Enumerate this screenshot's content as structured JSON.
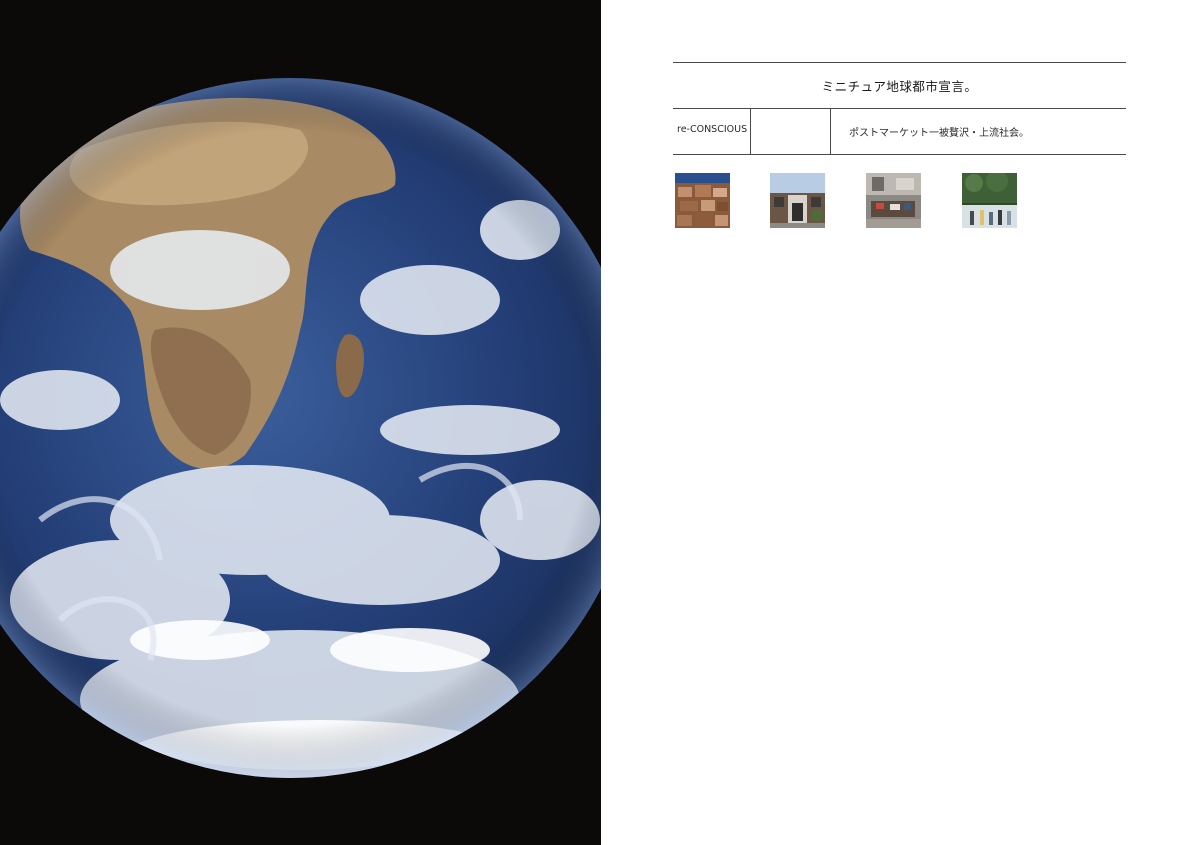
{
  "left_image": {
    "description_icon": "earth-photo",
    "background": "#0b0a09"
  },
  "header": {
    "title": "ミニチュア地球都市宣言。"
  },
  "info_row": {
    "category": "re-CONSCIOUS",
    "blank": "",
    "subtitle": "ポストマーケット一被贅沢・上流社会。"
  },
  "thumbnails": [
    {
      "icon": "stacked-boxes-photo"
    },
    {
      "icon": "building-facade-photo"
    },
    {
      "icon": "room-interior-photo"
    },
    {
      "icon": "people-outdoors-photo"
    }
  ]
}
